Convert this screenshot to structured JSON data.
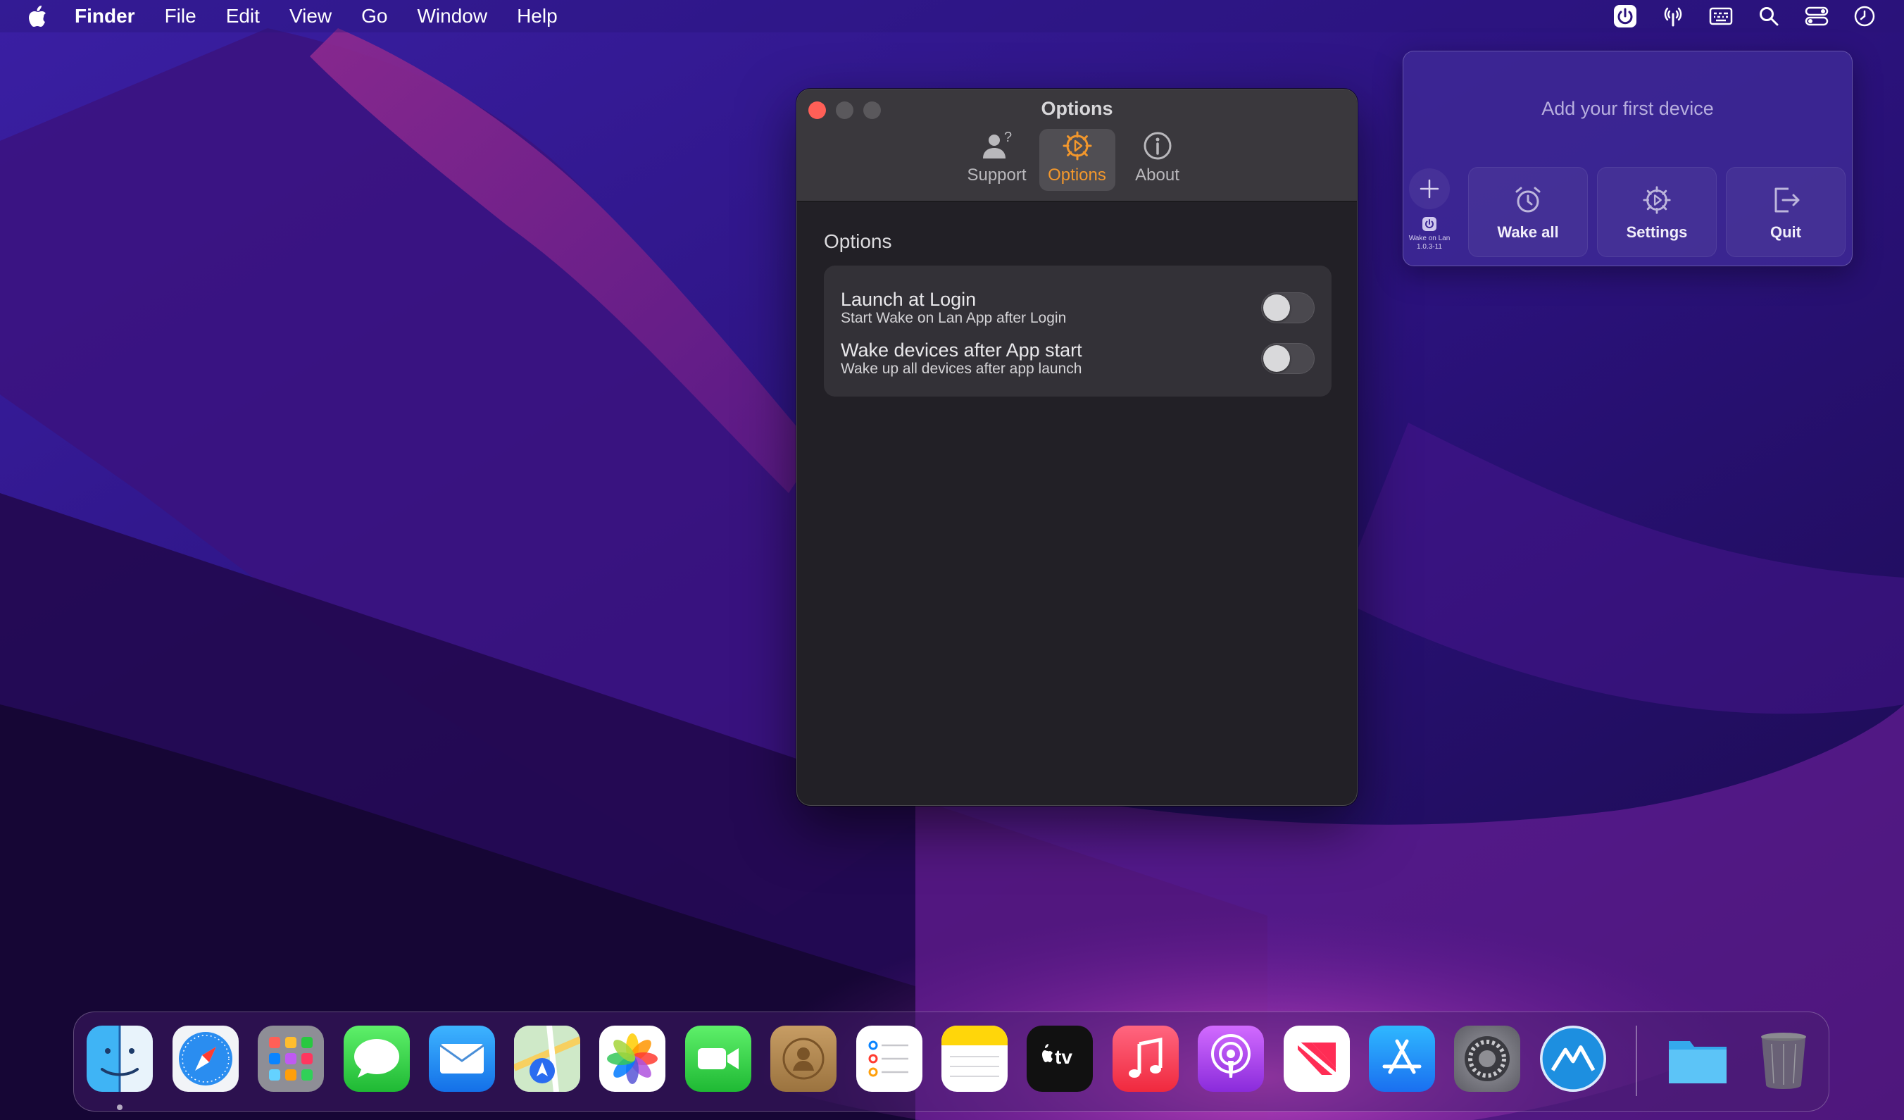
{
  "menubar": {
    "app_name": "Finder",
    "items": [
      "File",
      "Edit",
      "View",
      "Go",
      "Window",
      "Help"
    ],
    "status_icons": [
      "wake-on-lan-power-icon",
      "antenna-icon",
      "keyboard-icon",
      "search-icon",
      "control-center-icon",
      "clock-icon"
    ]
  },
  "window": {
    "title": "Options",
    "tabs": [
      {
        "label": "Support",
        "icon": "support-person-icon",
        "active": false
      },
      {
        "label": "Options",
        "icon": "gear-icon",
        "active": true
      },
      {
        "label": "About",
        "icon": "info-icon",
        "active": false
      }
    ],
    "section_title": "Options",
    "settings": [
      {
        "label": "Launch at Login",
        "sub": "Start Wake on Lan App after Login",
        "enabled": false
      },
      {
        "label": "Wake devices after App start",
        "sub": "Wake up all devices after app launch",
        "enabled": false
      }
    ]
  },
  "popover": {
    "empty_text": "Add your first device",
    "app_name": "Wake on Lan",
    "version": "1.0.3-11",
    "buttons": [
      {
        "label": "Wake all",
        "icon": "alarm-clock-icon"
      },
      {
        "label": "Settings",
        "icon": "gear-icon"
      },
      {
        "label": "Quit",
        "icon": "exit-icon"
      }
    ]
  },
  "dock": {
    "apps": [
      "Finder",
      "Safari",
      "Launchpad",
      "Messages",
      "Mail",
      "Maps",
      "Photos",
      "FaceTime",
      "Contacts",
      "Reminders",
      "Notes",
      "TV",
      "Music",
      "Podcasts",
      "News",
      "App Store",
      "System Preferences",
      "Wake on Lan",
      "Downloads",
      "Trash"
    ],
    "tv_label": "tv"
  },
  "colors": {
    "accent": "#f2972c",
    "window_bg": "#222026",
    "close_button": "#ff5f57"
  }
}
